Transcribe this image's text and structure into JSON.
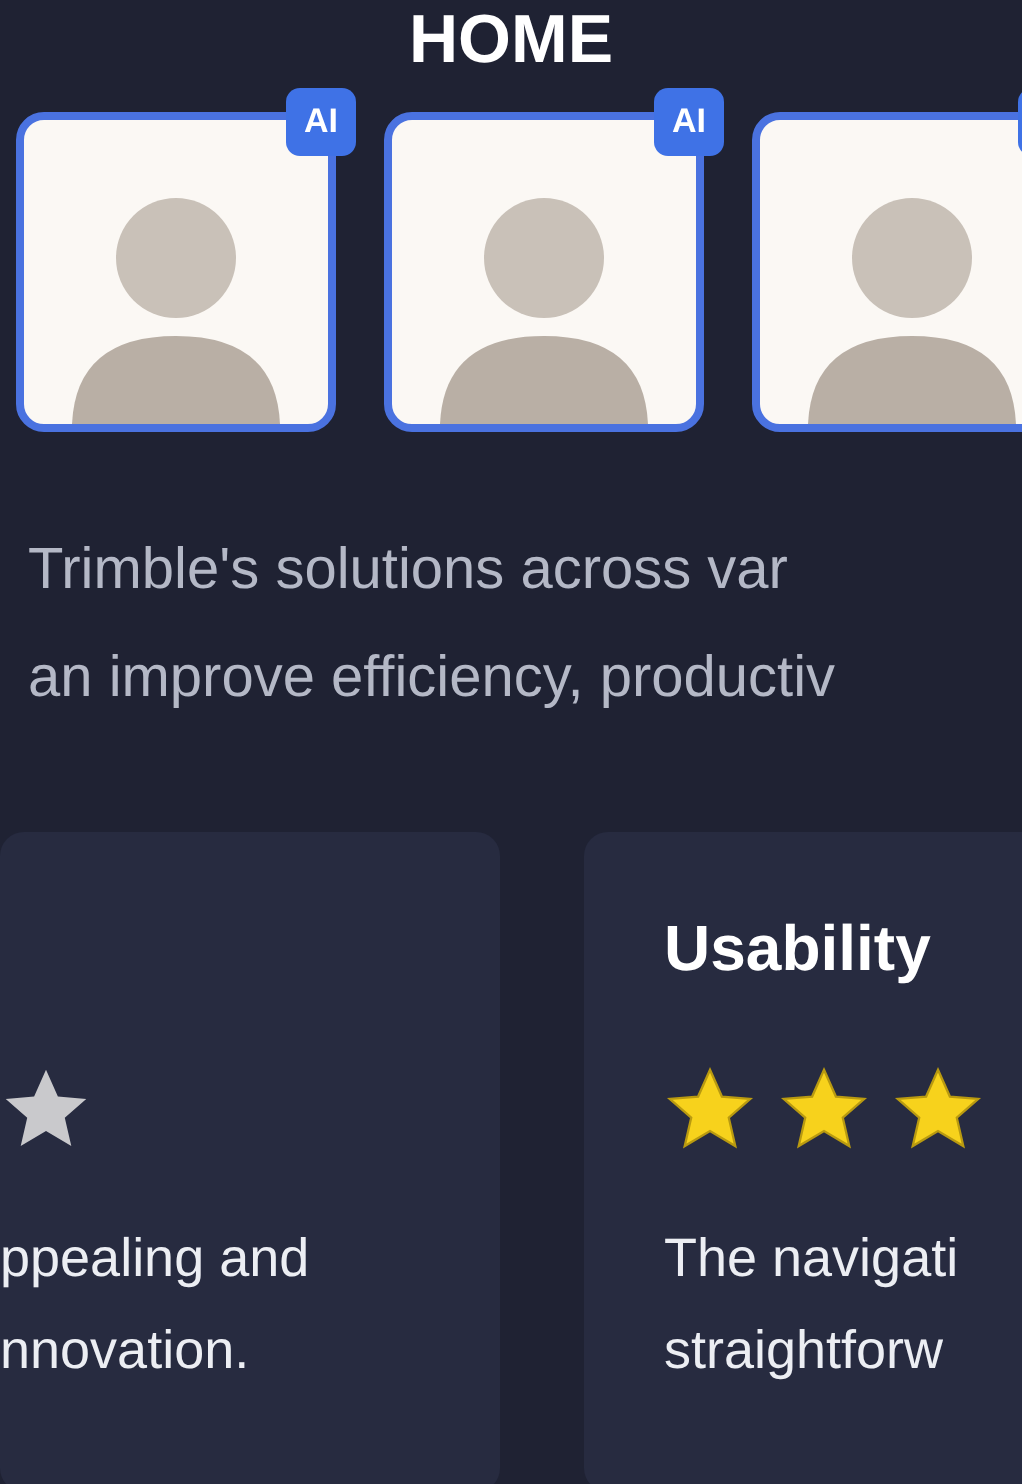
{
  "page": {
    "title": "HOME"
  },
  "avatars": [
    {
      "has_badge": true,
      "badge": "AI"
    },
    {
      "has_badge": true,
      "badge": "AI"
    },
    {
      "has_badge": true
    }
  ],
  "intro": [
    "Trimble's solutions across var",
    "an improve efficiency, productiv"
  ],
  "cards": [
    {
      "empty_star": true,
      "lines": [
        "ppealing and",
        "nnovation."
      ]
    },
    {
      "title": "Usability",
      "stars": 3,
      "lines": [
        "The navigati",
        "straightforw"
      ]
    }
  ]
}
